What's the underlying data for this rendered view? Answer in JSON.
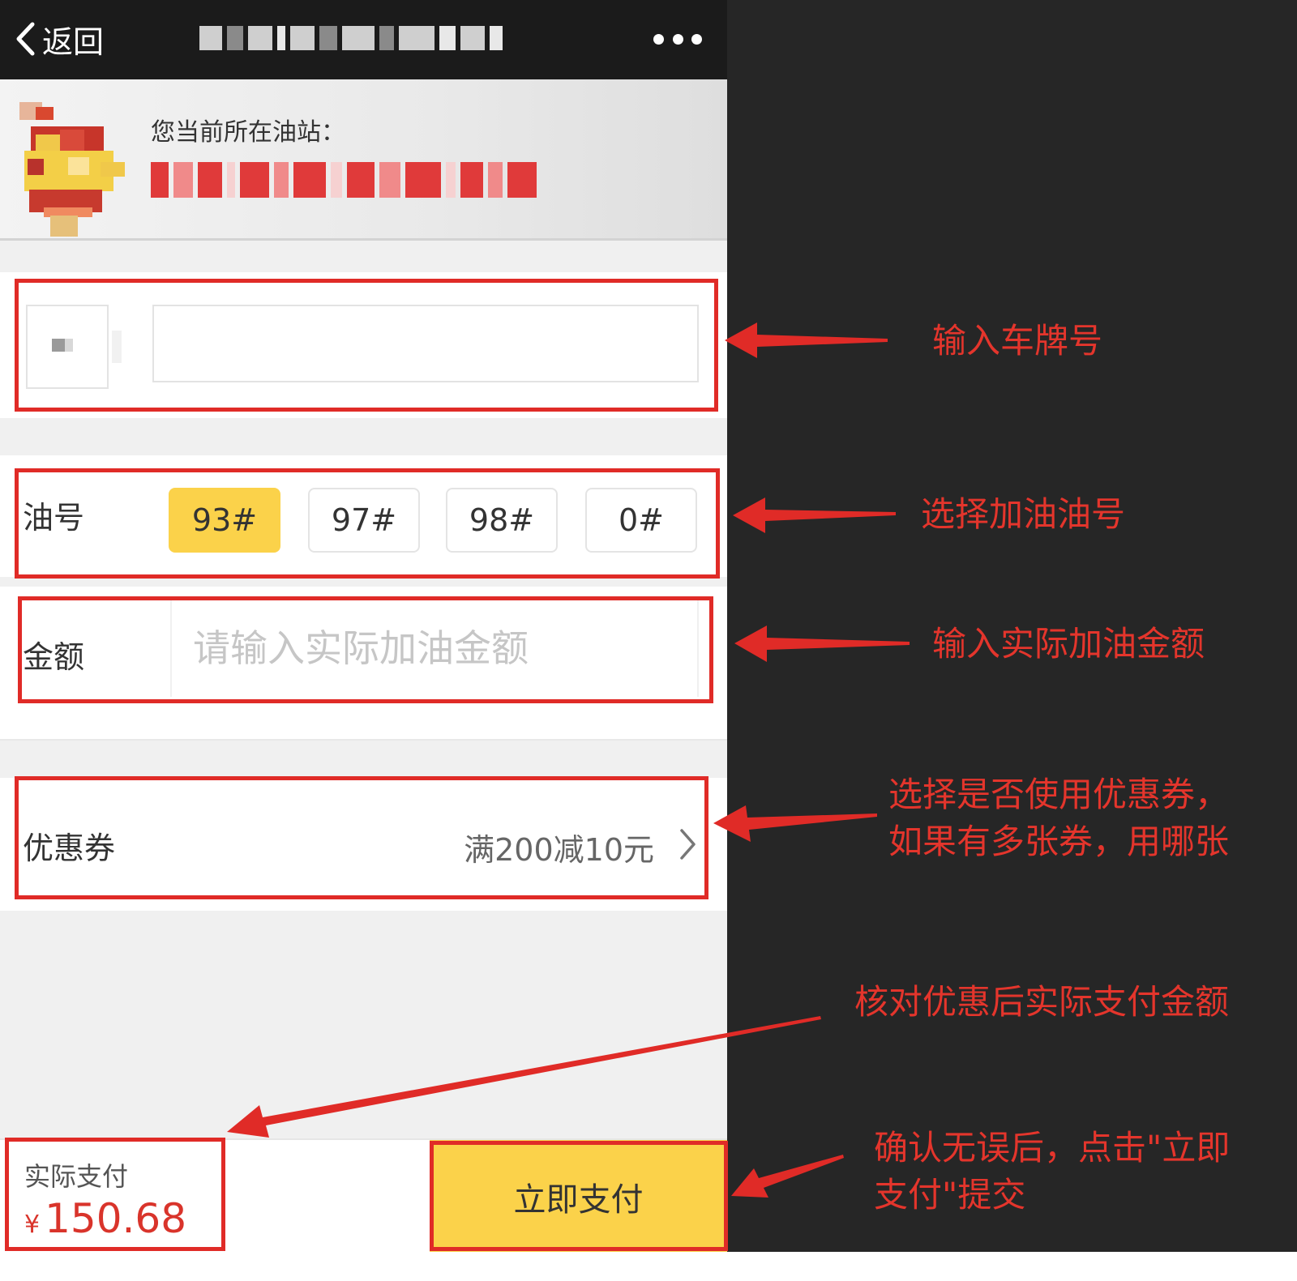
{
  "navbar": {
    "back_label": "返回",
    "title": "",
    "more_icon": "more-dots-icon"
  },
  "station": {
    "label": "您当前所在油站：",
    "name": ""
  },
  "plate": {
    "prefix": "",
    "value": ""
  },
  "fuel": {
    "label": "油号",
    "options": [
      "93#",
      "97#",
      "98#",
      "0#"
    ],
    "selected": "93#",
    "selected_color": "#fbd24a"
  },
  "amount": {
    "label": "金额",
    "placeholder": "请输入实际加油金额",
    "value": ""
  },
  "coupon": {
    "label": "优惠券",
    "value": "满200减10元",
    "chevron_icon": "chevron-right-icon"
  },
  "payment": {
    "label": "实际支付",
    "currency": "¥",
    "amount": "150.68",
    "button_label": "立即支付"
  },
  "annotations": {
    "plate": "输入车牌号",
    "fuel": "选择加油油号",
    "amount": "输入实际加油金额",
    "coupon_line1": "选择是否使用优惠券，",
    "coupon_line2": "如果有多张券，用哪张",
    "actual": "核对优惠后实际支付金额",
    "confirm_line1": "确认无误后，点击\"立即",
    "confirm_line2": "支付\"提交"
  },
  "colors": {
    "highlight": "#e02b27",
    "annotation_text": "#e4352c",
    "accent": "#fbd24a",
    "price": "#d9342b",
    "dark_background": "#262626"
  }
}
